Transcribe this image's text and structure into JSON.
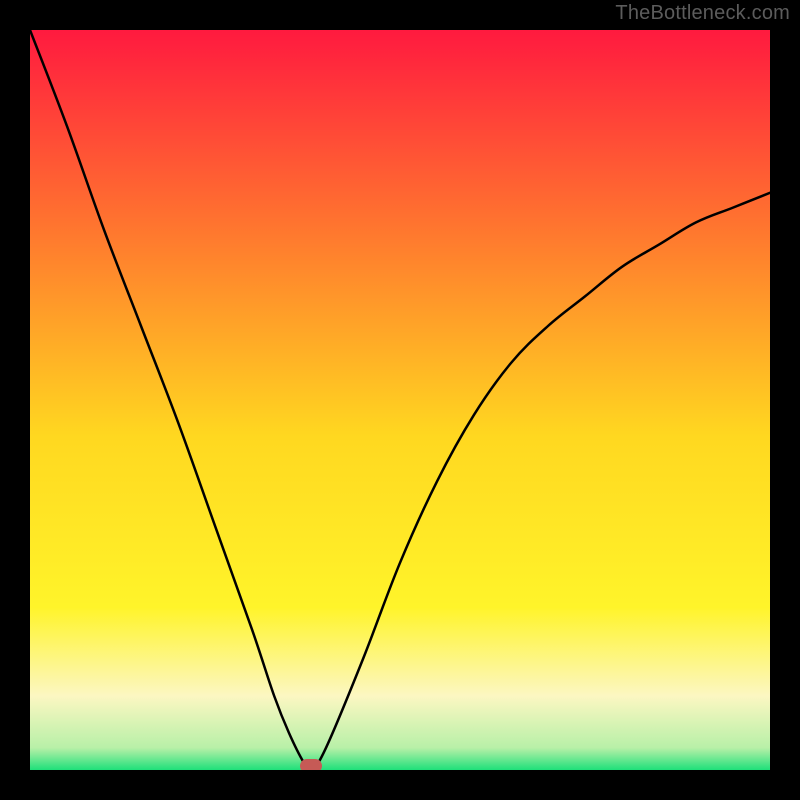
{
  "watermark": "TheBottleneck.com",
  "chart_data": {
    "type": "line",
    "title": "",
    "xlabel": "",
    "ylabel": "",
    "xlim": [
      0,
      100
    ],
    "ylim": [
      0,
      100
    ],
    "grid": false,
    "legend": false,
    "gradient_colors": {
      "top": "#ff1a3f",
      "upper_mid": "#ff8a2a",
      "mid": "#ffd820",
      "lower_mid": "#fff85a",
      "cream": "#fcf7c2",
      "green": "#1ee07a"
    },
    "series": [
      {
        "name": "bottleneck-curve",
        "x": [
          0,
          5,
          10,
          15,
          20,
          25,
          30,
          33,
          35,
          37,
          38,
          40,
          45,
          50,
          55,
          60,
          65,
          70,
          75,
          80,
          85,
          90,
          95,
          100
        ],
        "y": [
          100,
          87,
          73,
          60,
          47,
          33,
          19,
          10,
          5,
          1,
          0,
          3,
          15,
          28,
          39,
          48,
          55,
          60,
          64,
          68,
          71,
          74,
          76,
          78
        ]
      }
    ],
    "marker": {
      "x": 38,
      "y": 0,
      "color": "#c65a56"
    }
  }
}
